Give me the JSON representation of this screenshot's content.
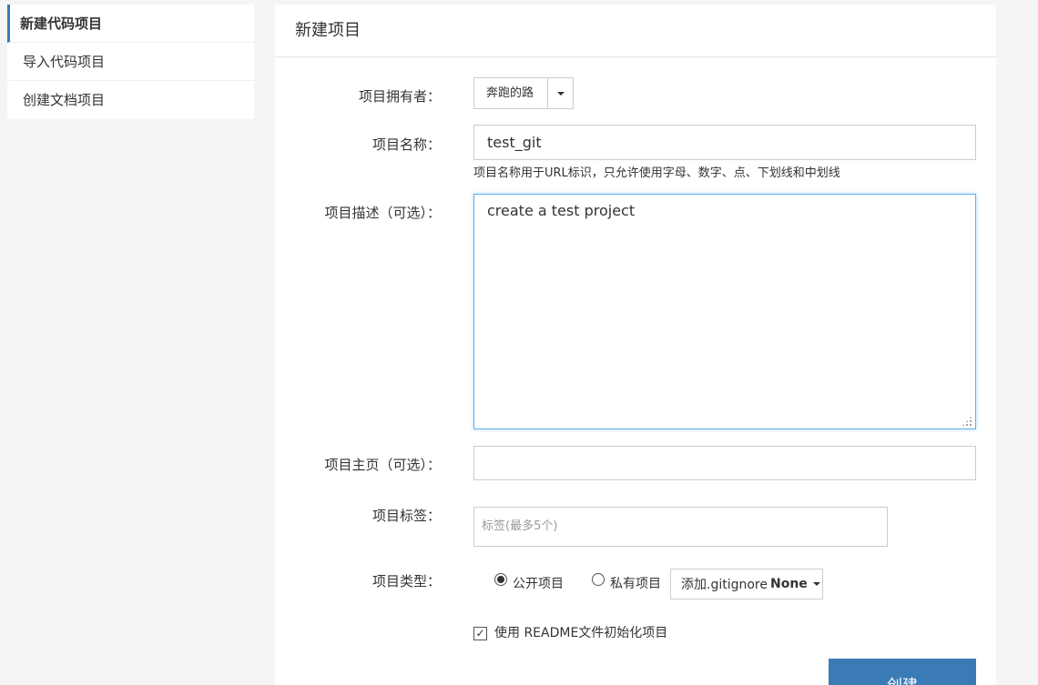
{
  "sidebar": {
    "items": [
      {
        "label": "新建代码项目"
      },
      {
        "label": "导入代码项目"
      },
      {
        "label": "创建文档项目"
      }
    ]
  },
  "panel": {
    "title": "新建项目"
  },
  "form": {
    "owner_label": "项目拥有者：",
    "owner_value": "奔跑的路",
    "name_label": "项目名称：",
    "name_value": "test_git",
    "name_hint": "项目名称用于URL标识，只允许使用字母、数字、点、下划线和中划线",
    "desc_label": "项目描述（可选）：",
    "desc_value": "create a test project",
    "homepage_label": "项目主页（可选）：",
    "homepage_value": "",
    "tags_label": "项目标签：",
    "tags_placeholder": "标签(最多5个)",
    "type_label": "项目类型：",
    "type_public": "公开项目",
    "type_private": "私有项目",
    "gitignore_prefix": "添加.gitignore",
    "gitignore_value": "None",
    "readme_label": "使用 README文件初始化项目",
    "create_button": "创建"
  },
  "colors": {
    "accent": "#3a7ab5",
    "focus_border": "#66afe9",
    "background": "#f5f5f5"
  }
}
